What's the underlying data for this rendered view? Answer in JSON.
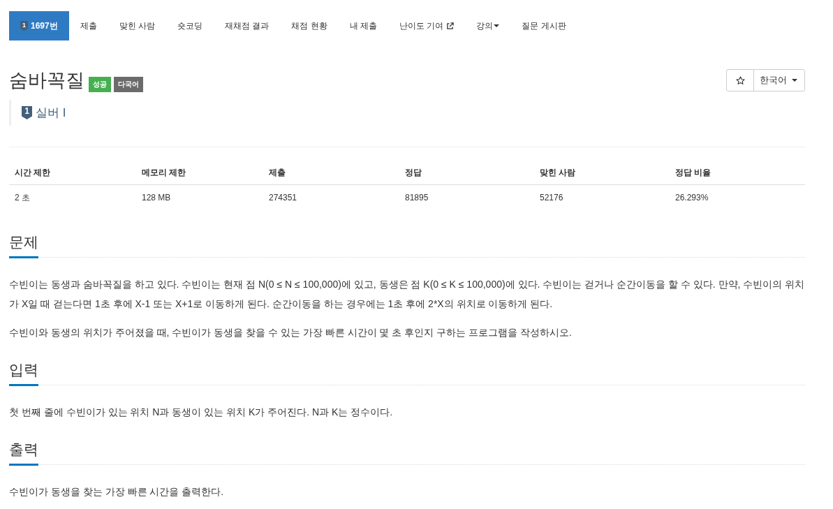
{
  "nav_tabs": [
    {
      "label": "1697번",
      "kind": "problem",
      "tier_mark": "1",
      "selected": true
    },
    {
      "label": "제출",
      "kind": "link",
      "selected": false
    },
    {
      "label": "맞힌 사람",
      "kind": "link",
      "selected": false
    },
    {
      "label": "숏코딩",
      "kind": "link",
      "selected": false
    },
    {
      "label": "재채점 결과",
      "kind": "link",
      "selected": false
    },
    {
      "label": "채점 현황",
      "kind": "link",
      "selected": false
    },
    {
      "label": "내 제출",
      "kind": "link",
      "selected": false
    },
    {
      "label": "난이도 기여",
      "kind": "external",
      "selected": false
    },
    {
      "label": "강의",
      "kind": "dropdown",
      "selected": false
    },
    {
      "label": "질문 게시판",
      "kind": "link",
      "selected": false
    }
  ],
  "problem": {
    "title": "숨바꼭질",
    "badges": [
      {
        "label": "성공",
        "color": "#44b04f"
      },
      {
        "label": "다국어",
        "color": "#6b6b6b"
      }
    ],
    "tier": {
      "mark": "1",
      "label": "실버 I"
    }
  },
  "actions": {
    "starred": false,
    "language": "한국어"
  },
  "info_table": {
    "columns": [
      "시간 제한",
      "메모리 제한",
      "제출",
      "정답",
      "맞힌 사람",
      "정답 비율"
    ],
    "rows": [
      [
        "2 초",
        "128 MB",
        "274351",
        "81895",
        "52176",
        "26.293%"
      ]
    ]
  },
  "sections": [
    {
      "heading": "문제",
      "paragraphs": [
        "수빈이는 동생과 숨바꼭질을 하고 있다. 수빈이는 현재 점 N(0 ≤ N ≤ 100,000)에 있고, 동생은 점 K(0 ≤ K ≤ 100,000)에 있다. 수빈이는 걷거나 순간이동을 할 수 있다. 만약, 수빈이의 위치가 X일 때 걷는다면 1초 후에 X-1 또는 X+1로 이동하게 된다. 순간이동을 하는 경우에는 1초 후에 2*X의 위치로 이동하게 된다.",
        "수빈이와 동생의 위치가 주어졌을 때, 수빈이가 동생을 찾을 수 있는 가장 빠른 시간이 몇 초 후인지 구하는 프로그램을 작성하시오."
      ]
    },
    {
      "heading": "입력",
      "paragraphs": [
        "첫 번째 줄에 수빈이가 있는 위치 N과 동생이 있는 위치 K가 주어진다. N과 K는 정수이다."
      ]
    },
    {
      "heading": "출력",
      "paragraphs": [
        "수빈이가 동생을 찾는 가장 빠른 시간을 출력한다."
      ]
    }
  ]
}
